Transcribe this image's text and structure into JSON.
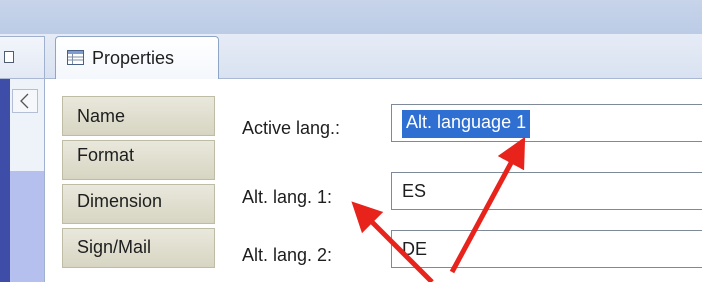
{
  "tabs": {
    "properties_label": "Properties"
  },
  "categories": [
    {
      "label": "Name"
    },
    {
      "label": "Format"
    },
    {
      "label": "Dimension"
    },
    {
      "label": "Sign/Mail"
    }
  ],
  "fields": {
    "active_lang_label": "Active lang.:",
    "active_lang_value": "Alt. language 1",
    "alt_lang1_label": "Alt. lang. 1:",
    "alt_lang1_value": "ES",
    "alt_lang2_label": "Alt. lang. 2:",
    "alt_lang2_value": "DE"
  },
  "icons": {
    "tab_icon": "properties-table-icon",
    "collapse": "chevron-left-icon",
    "left_stub": "window-box-icon"
  },
  "colors": {
    "selection": "#2f6fd1",
    "arrow": "#e8231c",
    "category_bg": "#d7d5c2",
    "header_band": "#c7d4ea"
  }
}
